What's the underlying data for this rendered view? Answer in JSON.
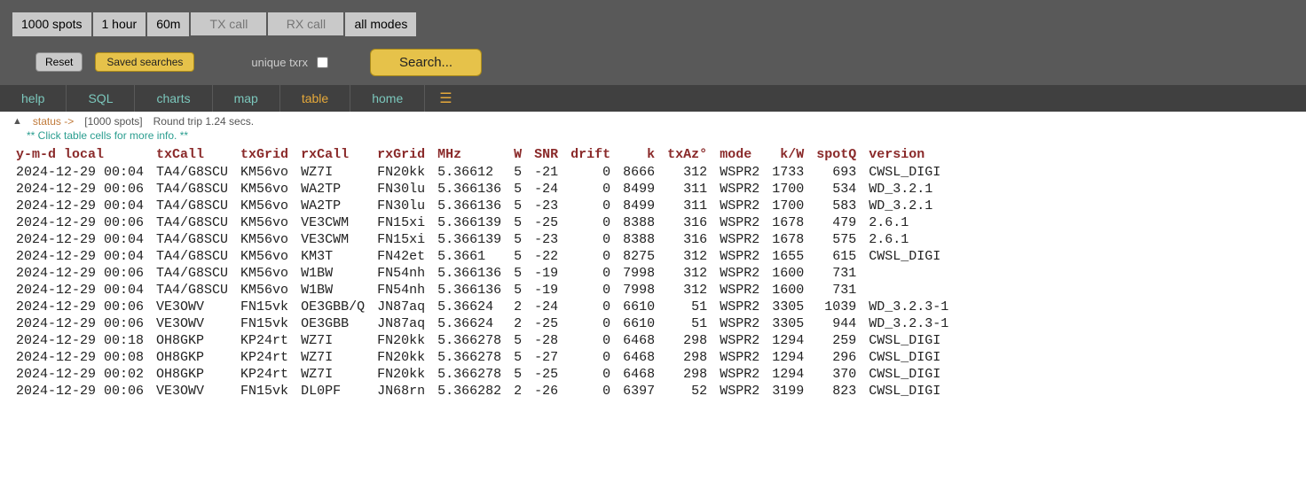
{
  "filters": {
    "spots": "1000 spots",
    "time": "1 hour",
    "band": "60m",
    "tx_placeholder": "TX call",
    "rx_placeholder": "RX call",
    "modes": "all modes"
  },
  "actions": {
    "reset": "Reset",
    "saved": "Saved searches",
    "unique": "unique txrx",
    "search": "Search..."
  },
  "nav": {
    "help": "help",
    "sql": "SQL",
    "charts": "charts",
    "map": "map",
    "table": "table",
    "home": "home"
  },
  "status": {
    "label": "status ->",
    "count": "[1000 spots]",
    "rt": "Round trip 1.24 secs."
  },
  "hint": "**  Click table cells for more info.    **",
  "headers": {
    "ts": "y-m-d local",
    "txcall": "txCall",
    "txgrid": "txGrid",
    "rxcall": "rxCall",
    "rxgrid": "rxGrid",
    "mhz": "MHz",
    "w": "W",
    "snr": "SNR",
    "drift": "drift",
    "k": "k",
    "txaz": "txAz°",
    "mode": "mode",
    "kw": "k/W",
    "spotq": "spotQ",
    "version": "version"
  },
  "rows": [
    {
      "ts": "2024-12-29 00:04",
      "txcall": "TA4/G8SCU",
      "txgrid": "KM56vo",
      "rxcall": "WZ7I",
      "rxgrid": "FN20kk",
      "mhz": "5.36612",
      "w": "5",
      "snr": "-21",
      "drift": "0",
      "k": "8666",
      "txaz": "312",
      "mode": "WSPR2",
      "kw": "1733",
      "spotq": "693",
      "version": "CWSL_DIGI"
    },
    {
      "ts": "2024-12-29 00:06",
      "txcall": "TA4/G8SCU",
      "txgrid": "KM56vo",
      "rxcall": "WA2TP",
      "rxgrid": "FN30lu",
      "mhz": "5.366136",
      "w": "5",
      "snr": "-24",
      "drift": "0",
      "k": "8499",
      "txaz": "311",
      "mode": "WSPR2",
      "kw": "1700",
      "spotq": "534",
      "version": "WD_3.2.1"
    },
    {
      "ts": "2024-12-29 00:04",
      "txcall": "TA4/G8SCU",
      "txgrid": "KM56vo",
      "rxcall": "WA2TP",
      "rxgrid": "FN30lu",
      "mhz": "5.366136",
      "w": "5",
      "snr": "-23",
      "drift": "0",
      "k": "8499",
      "txaz": "311",
      "mode": "WSPR2",
      "kw": "1700",
      "spotq": "583",
      "version": "WD_3.2.1"
    },
    {
      "ts": "2024-12-29 00:06",
      "txcall": "TA4/G8SCU",
      "txgrid": "KM56vo",
      "rxcall": "VE3CWM",
      "rxgrid": "FN15xi",
      "mhz": "5.366139",
      "w": "5",
      "snr": "-25",
      "drift": "0",
      "k": "8388",
      "txaz": "316",
      "mode": "WSPR2",
      "kw": "1678",
      "spotq": "479",
      "version": "2.6.1"
    },
    {
      "ts": "2024-12-29 00:04",
      "txcall": "TA4/G8SCU",
      "txgrid": "KM56vo",
      "rxcall": "VE3CWM",
      "rxgrid": "FN15xi",
      "mhz": "5.366139",
      "w": "5",
      "snr": "-23",
      "drift": "0",
      "k": "8388",
      "txaz": "316",
      "mode": "WSPR2",
      "kw": "1678",
      "spotq": "575",
      "version": "2.6.1"
    },
    {
      "ts": "2024-12-29 00:04",
      "txcall": "TA4/G8SCU",
      "txgrid": "KM56vo",
      "rxcall": "KM3T",
      "rxgrid": "FN42et",
      "mhz": "5.3661",
      "w": "5",
      "snr": "-22",
      "drift": "0",
      "k": "8275",
      "txaz": "312",
      "mode": "WSPR2",
      "kw": "1655",
      "spotq": "615",
      "version": "CWSL_DIGI"
    },
    {
      "ts": "2024-12-29 00:06",
      "txcall": "TA4/G8SCU",
      "txgrid": "KM56vo",
      "rxcall": "W1BW",
      "rxgrid": "FN54nh",
      "mhz": "5.366136",
      "w": "5",
      "snr": "-19",
      "drift": "0",
      "k": "7998",
      "txaz": "312",
      "mode": "WSPR2",
      "kw": "1600",
      "spotq": "731",
      "version": ""
    },
    {
      "ts": "2024-12-29 00:04",
      "txcall": "TA4/G8SCU",
      "txgrid": "KM56vo",
      "rxcall": "W1BW",
      "rxgrid": "FN54nh",
      "mhz": "5.366136",
      "w": "5",
      "snr": "-19",
      "drift": "0",
      "k": "7998",
      "txaz": "312",
      "mode": "WSPR2",
      "kw": "1600",
      "spotq": "731",
      "version": ""
    },
    {
      "ts": "2024-12-29 00:06",
      "txcall": "VE3OWV",
      "txgrid": "FN15vk",
      "rxcall": "OE3GBB/Q",
      "rxgrid": "JN87aq",
      "mhz": "5.36624",
      "w": "2",
      "snr": "-24",
      "drift": "0",
      "k": "6610",
      "txaz": "51",
      "mode": "WSPR2",
      "kw": "3305",
      "spotq": "1039",
      "version": "WD_3.2.3-1"
    },
    {
      "ts": "2024-12-29 00:06",
      "txcall": "VE3OWV",
      "txgrid": "FN15vk",
      "rxcall": "OE3GBB",
      "rxgrid": "JN87aq",
      "mhz": "5.36624",
      "w": "2",
      "snr": "-25",
      "drift": "0",
      "k": "6610",
      "txaz": "51",
      "mode": "WSPR2",
      "kw": "3305",
      "spotq": "944",
      "version": "WD_3.2.3-1"
    },
    {
      "ts": "2024-12-29 00:18",
      "txcall": "OH8GKP",
      "txgrid": "KP24rt",
      "rxcall": "WZ7I",
      "rxgrid": "FN20kk",
      "mhz": "5.366278",
      "w": "5",
      "snr": "-28",
      "drift": "0",
      "k": "6468",
      "txaz": "298",
      "mode": "WSPR2",
      "kw": "1294",
      "spotq": "259",
      "version": "CWSL_DIGI"
    },
    {
      "ts": "2024-12-29 00:08",
      "txcall": "OH8GKP",
      "txgrid": "KP24rt",
      "rxcall": "WZ7I",
      "rxgrid": "FN20kk",
      "mhz": "5.366278",
      "w": "5",
      "snr": "-27",
      "drift": "0",
      "k": "6468",
      "txaz": "298",
      "mode": "WSPR2",
      "kw": "1294",
      "spotq": "296",
      "version": "CWSL_DIGI"
    },
    {
      "ts": "2024-12-29 00:02",
      "txcall": "OH8GKP",
      "txgrid": "KP24rt",
      "rxcall": "WZ7I",
      "rxgrid": "FN20kk",
      "mhz": "5.366278",
      "w": "5",
      "snr": "-25",
      "drift": "0",
      "k": "6468",
      "txaz": "298",
      "mode": "WSPR2",
      "kw": "1294",
      "spotq": "370",
      "version": "CWSL_DIGI"
    },
    {
      "ts": "2024-12-29 00:06",
      "txcall": "VE3OWV",
      "txgrid": "FN15vk",
      "rxcall": "DL0PF",
      "rxgrid": "JN68rn",
      "mhz": "5.366282",
      "w": "2",
      "snr": "-26",
      "drift": "0",
      "k": "6397",
      "txaz": "52",
      "mode": "WSPR2",
      "kw": "3199",
      "spotq": "823",
      "version": "CWSL_DIGI"
    }
  ]
}
